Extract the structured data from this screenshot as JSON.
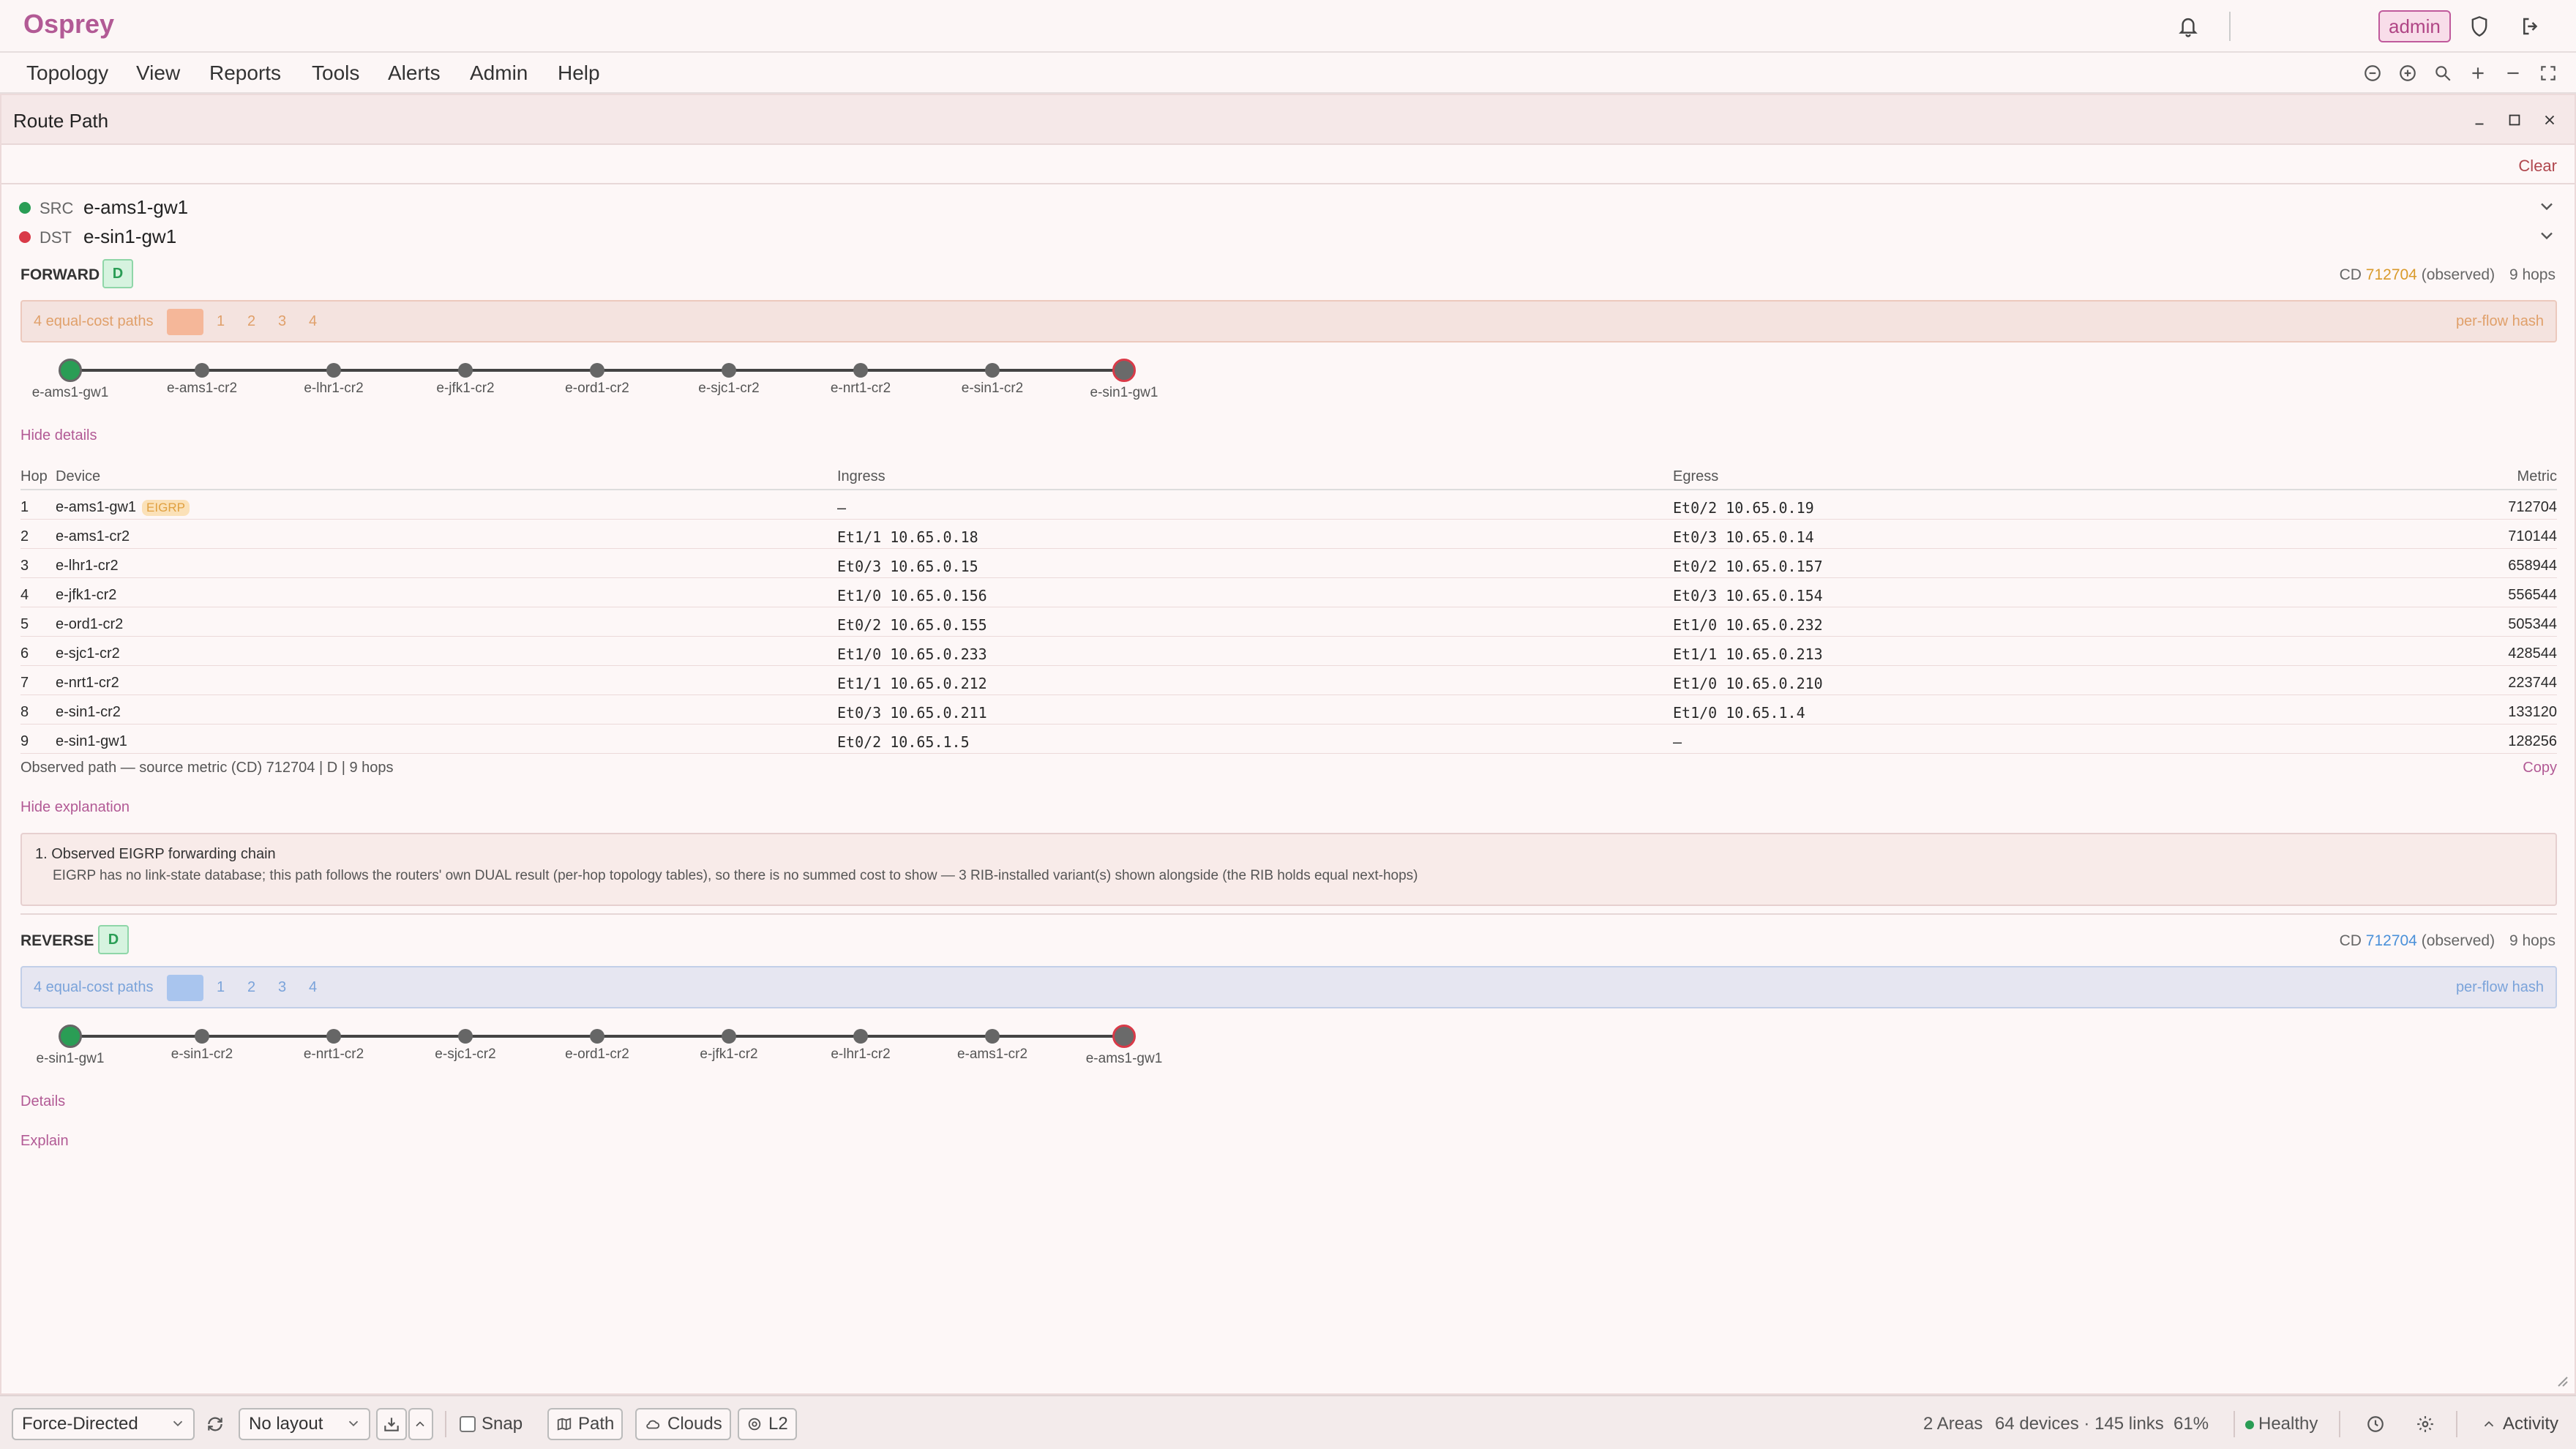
{
  "app": {
    "brand": "Osprey",
    "user": "admin"
  },
  "menu": [
    "Topology",
    "View",
    "Reports",
    "Tools",
    "Alerts",
    "Admin",
    "Help"
  ],
  "panel": {
    "title": "Route Path",
    "clear_label": "Clear"
  },
  "src": {
    "label": "SRC",
    "value": "e-ams1-gw1"
  },
  "dst": {
    "label": "DST",
    "value": "e-sin1-gw1"
  },
  "forward": {
    "label": "FORWARD",
    "badge": "D",
    "cd_prefix": "CD",
    "cd_value": "712704",
    "cd_suffix": "(observed)",
    "hops_text": "9 hops",
    "ecmp_label": "4 equal-cost paths",
    "ecmp_paths": [
      "1",
      "2",
      "3",
      "4"
    ],
    "hash_label": "per-flow hash",
    "path": [
      "e-ams1-gw1",
      "e-ams1-cr2",
      "e-lhr1-cr2",
      "e-jfk1-cr2",
      "e-ord1-cr2",
      "e-sjc1-cr2",
      "e-nrt1-cr2",
      "e-sin1-cr2",
      "e-sin1-gw1"
    ],
    "details_toggle": "Hide details",
    "explain_toggle": "Hide explanation",
    "observed_summary": "Observed path — source metric (CD) 712704 | D | 9 hops",
    "copy_label": "Copy",
    "table": {
      "headers": {
        "hop": "Hop",
        "device": "Device",
        "ingress": "Ingress",
        "egress": "Egress",
        "metric": "Metric"
      },
      "rows": [
        {
          "hop": "1",
          "device": "e-ams1-gw1",
          "tag": "EIGRP",
          "ingress": "–",
          "egress": "Et0/2 10.65.0.19",
          "metric": "712704"
        },
        {
          "hop": "2",
          "device": "e-ams1-cr2",
          "tag": "",
          "ingress": "Et1/1 10.65.0.18",
          "egress": "Et0/3 10.65.0.14",
          "metric": "710144"
        },
        {
          "hop": "3",
          "device": "e-lhr1-cr2",
          "tag": "",
          "ingress": "Et0/3 10.65.0.15",
          "egress": "Et0/2 10.65.0.157",
          "metric": "658944"
        },
        {
          "hop": "4",
          "device": "e-jfk1-cr2",
          "tag": "",
          "ingress": "Et1/0 10.65.0.156",
          "egress": "Et0/3 10.65.0.154",
          "metric": "556544"
        },
        {
          "hop": "5",
          "device": "e-ord1-cr2",
          "tag": "",
          "ingress": "Et0/2 10.65.0.155",
          "egress": "Et1/0 10.65.0.232",
          "metric": "505344"
        },
        {
          "hop": "6",
          "device": "e-sjc1-cr2",
          "tag": "",
          "ingress": "Et1/0 10.65.0.233",
          "egress": "Et1/1 10.65.0.213",
          "metric": "428544"
        },
        {
          "hop": "7",
          "device": "e-nrt1-cr2",
          "tag": "",
          "ingress": "Et1/1 10.65.0.212",
          "egress": "Et1/0 10.65.0.210",
          "metric": "223744"
        },
        {
          "hop": "8",
          "device": "e-sin1-cr2",
          "tag": "",
          "ingress": "Et0/3 10.65.0.211",
          "egress": "Et1/0 10.65.1.4",
          "metric": "133120"
        },
        {
          "hop": "9",
          "device": "e-sin1-gw1",
          "tag": "",
          "ingress": "Et0/2 10.65.1.5",
          "egress": "–",
          "metric": "128256"
        }
      ]
    },
    "explanation": {
      "step": "1. Observed EIGRP forwarding chain",
      "text": "EIGRP has no link-state database; this path follows the routers' own DUAL result (per-hop topology tables), so there is no summed cost to show — 3 RIB-installed variant(s) shown alongside (the RIB holds equal next-hops)"
    }
  },
  "reverse": {
    "label": "REVERSE",
    "badge": "D",
    "cd_prefix": "CD",
    "cd_value": "712704",
    "cd_suffix": "(observed)",
    "hops_text": "9 hops",
    "ecmp_label": "4 equal-cost paths",
    "ecmp_paths": [
      "1",
      "2",
      "3",
      "4"
    ],
    "hash_label": "per-flow hash",
    "path": [
      "e-sin1-gw1",
      "e-sin1-cr2",
      "e-nrt1-cr2",
      "e-sjc1-cr2",
      "e-ord1-cr2",
      "e-jfk1-cr2",
      "e-lhr1-cr2",
      "e-ams1-cr2",
      "e-ams1-gw1"
    ],
    "details_toggle": "Details",
    "explain_toggle": "Explain"
  },
  "statusbar": {
    "layout_engine": "Force-Directed",
    "layout_preset": "No layout",
    "snap_label": "Snap",
    "path_label": "Path",
    "clouds_label": "Clouds",
    "l2_label": "L2",
    "areas": "2 Areas",
    "counts": "64 devices · 145 links",
    "zoom": "61%",
    "health": "Healthy",
    "activity": "Activity"
  },
  "colors": {
    "brand": "#b25a95",
    "forward_cd": "#d99a2b",
    "reverse_cd": "#4a90d9",
    "src": "#2a9d55",
    "dst": "#d93a48"
  }
}
